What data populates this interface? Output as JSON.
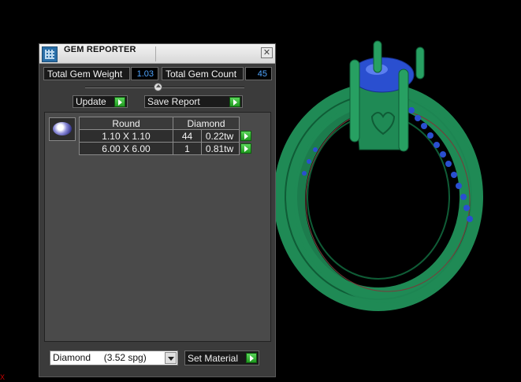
{
  "window": {
    "title": "GEM REPORTER",
    "close_glyph": "✕"
  },
  "stats": {
    "total_weight_label": "Total Gem Weight",
    "total_weight_value": "1.03",
    "total_count_label": "Total Gem Count",
    "total_count_value": "45"
  },
  "actions": {
    "update_label": "Update",
    "save_report_label": "Save Report"
  },
  "gems": {
    "shape_header": "Round",
    "material_header": "Diamond",
    "rows": [
      {
        "size": "1.10 X 1.10",
        "qty": "44",
        "weight": "0.22tw"
      },
      {
        "size": "6.00 X 6.00",
        "qty": "1",
        "weight": "0.81tw"
      }
    ]
  },
  "material": {
    "selected": "Diamond     (3.52 spg)",
    "set_label": "Set Material"
  },
  "viewport": {
    "axis_label": "X",
    "model_color": "#1f8a55",
    "gem_color": "#2a4fd0"
  }
}
